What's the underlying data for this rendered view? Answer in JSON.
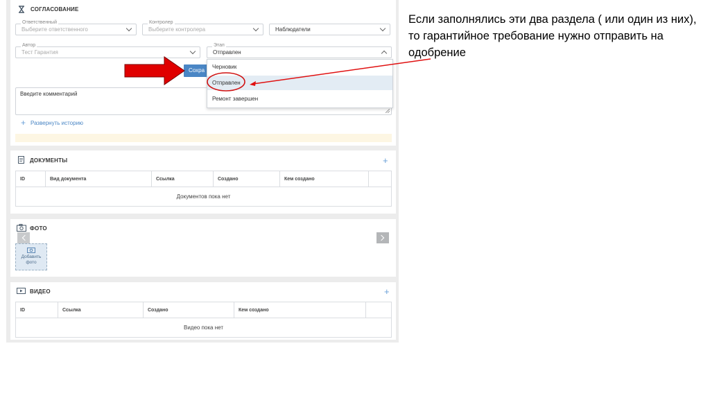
{
  "approval": {
    "title": "СОГЛАСОВАНИЕ",
    "responsible": {
      "label": "Ответственный",
      "placeholder": "Выберите ответственного"
    },
    "controller": {
      "label": "Контролер",
      "placeholder": "Выберите контролера"
    },
    "observers": {
      "value": "Наблюдатели"
    },
    "author": {
      "label": "Автор",
      "value": "Тест Гарантия"
    },
    "stage": {
      "label": "Этап",
      "value": "Отправлен",
      "options": [
        "Черновик",
        "Отправлен",
        "Ремонт завершен"
      ],
      "selected_index": 1
    },
    "save_button": "Сохра",
    "comment_placeholder": "Введите комментарий",
    "expand_history": "Развернуть историю"
  },
  "documents": {
    "title": "ДОКУМЕНТЫ",
    "columns": [
      "ID",
      "Вид документа",
      "Ссылка",
      "Создано",
      "Кем создано"
    ],
    "empty_text": "Документов пока нет"
  },
  "photo": {
    "title": "ФОТО",
    "add_label_line1": "Добавить",
    "add_label_line2": "фото"
  },
  "video": {
    "title": "ВИДЕО",
    "columns": [
      "ID",
      "Ссылка",
      "Создано",
      "Кем создано"
    ],
    "empty_text": "Видео пока нет"
  },
  "annotation_text": "Если заполнялись эти два раздела ( или один из них), то гарантийное требование нужно отправить на одобрение",
  "colors": {
    "accent": "#4a86c5",
    "red_arrow": "#e00000",
    "annotation_line": "#e01010",
    "selected_option_bg": "#e3ecf4",
    "notice_bar": "#fdf6e3"
  }
}
